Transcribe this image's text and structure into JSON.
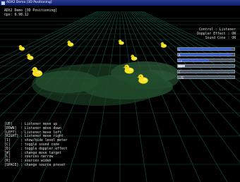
{
  "window": {
    "title": "ADX2 Demo [3D Positioning]"
  },
  "hud": {
    "app_title": "ADX2 Demo [3D Positioning]",
    "fps": "cps: 6.98.12",
    "control": "Control : Listener",
    "doppler": "Doppler Effect : ON",
    "sound_cone": "Sound Cone : ON"
  },
  "meters": [
    {
      "label": "L",
      "level": 0.95,
      "color": "#3b5fd0"
    },
    {
      "label": "R",
      "level": 0.95,
      "color": "#3b5fd0"
    },
    {
      "label": "Ls",
      "level": 0.55,
      "color": "#3b5fd0"
    },
    {
      "label": "Rs",
      "level": 0.12,
      "color": "#c8d0e0"
    },
    {
      "label": "C",
      "level": 0.0,
      "color": "#3b5fd0"
    },
    {
      "label": "LFE",
      "level": 0.0,
      "color": "#3b5fd0"
    }
  ],
  "help": [
    {
      "key": "[UP]",
      "desc": ": Listener move up"
    },
    {
      "key": "[DOWN]",
      "desc": ": Listener move down"
    },
    {
      "key": "[LEFT]",
      "desc": ": Listener move left"
    },
    {
      "key": "[RIGHT]",
      "desc": ": Listener move right"
    },
    {
      "key": "[1]",
      "desc": ": show/hide level meter"
    },
    {
      "key": "[C]",
      "desc": ": toggle sound cone"
    },
    {
      "key": "[D]",
      "desc": ": toggle doppler effect"
    },
    {
      "key": "[W]",
      "desc": ": change move target"
    },
    {
      "key": "[L]",
      "desc": ": sources narrow"
    },
    {
      "key": "[R]",
      "desc": ": sources widen"
    },
    {
      "key": "[SPACE]",
      "desc": ": change source preset"
    }
  ],
  "colors": {
    "grid": "#1f6a52",
    "cone": "#2c5a38",
    "duck": "#f5e020",
    "beak": "#e08a10"
  }
}
